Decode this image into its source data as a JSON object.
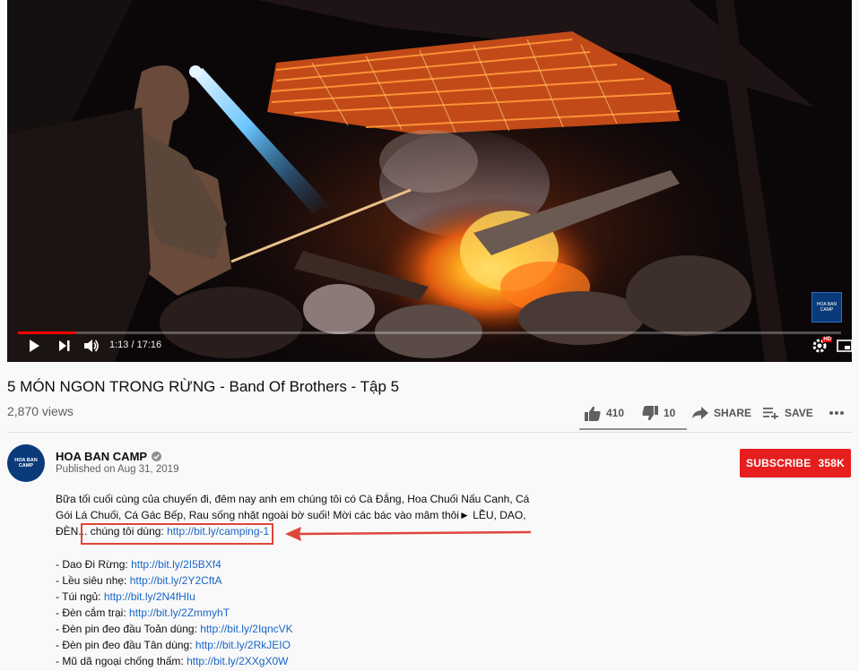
{
  "player": {
    "time_current": "1:13",
    "time_total": "17:16",
    "time_separator": "/",
    "progress_fraction": 0.071,
    "watermark_label": "HOA BAN CAMP",
    "hd_badge": "HD",
    "scene_description_icon": "campfire-video-frame"
  },
  "video": {
    "title": "5 MÓN NGON TRONG RỪNG - Band Of Brothers - Tập 5",
    "views": "2,870 views",
    "likes": "410",
    "dislikes": "10",
    "share_label": "SHARE",
    "save_label": "SAVE"
  },
  "channel": {
    "name": "HOA BAN CAMP",
    "avatar_label": "HOA BAN CAMP",
    "published": "Published on Aug 31, 2019",
    "subscribe_label": "SUBSCRIBE",
    "subscriber_count": "358K"
  },
  "description": {
    "line1": "Bữa tối cuối cùng của chuyến đi, đêm nay anh em chúng tôi có Cà Đắng, Hoa Chuối Nấu Canh, Cá",
    "line2": "Gói Lá Chuối, Cá Gác Bếp, Rau sống nhặt ngoài bờ suối! Mời các bác vào mâm thôi► LỀU, DAO,",
    "line3_prefix": "ĐÈN...",
    "line3_text": "chúng tôi dùng:",
    "line3_link": "http://bit.ly/camping-1",
    "items": [
      {
        "label": "- Dao Đi Rừng:",
        "link": "http://bit.ly/2I5BXf4"
      },
      {
        "label": "- Lều siêu nhẹ:",
        "link": "http://bit.ly/2Y2CftA"
      },
      {
        "label": "- Túi ngủ:",
        "link": "http://bit.ly/2N4fHIu"
      },
      {
        "label": "- Đèn cắm trại:",
        "link": "http://bit.ly/2ZmmyhT"
      },
      {
        "label": "- Đèn pin đeo đầu Toản dùng:",
        "link": "http://bit.ly/2IqncVK"
      },
      {
        "label": "- Đèn pin đeo đầu Tân dùng:",
        "link": "http://bit.ly/2RkJEIO"
      },
      {
        "label": "- Mũ dã ngoại chống thấm:",
        "link": "http://bit.ly/2XXgX0W"
      }
    ]
  },
  "colors": {
    "subscribe_bg": "#e61e1e",
    "link": "#1a65c7",
    "highlight": "#e0453a",
    "progress": "#ff0000"
  }
}
